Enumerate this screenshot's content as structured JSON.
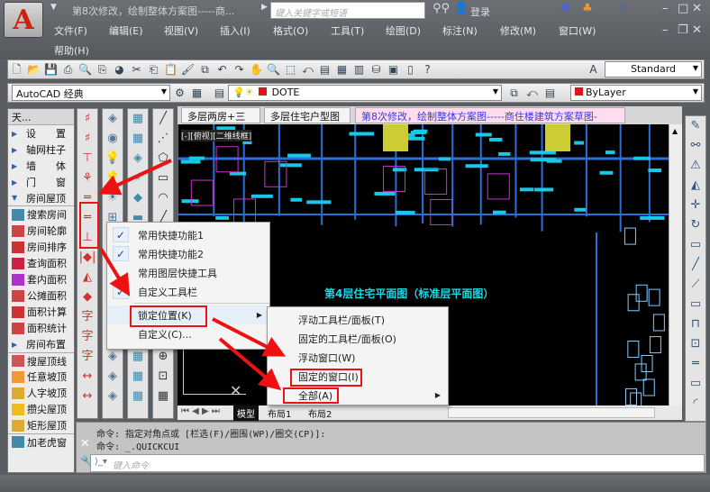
{
  "titlebar": {
    "title": "第8次修改，绘制整体方案图-----商...",
    "search_placeholder": "键入关键字或短语",
    "login": "登录"
  },
  "menu": [
    "文件(F)",
    "编辑(E)",
    "视图(V)",
    "插入(I)",
    "格式(O)",
    "工具(T)",
    "绘图(D)",
    "标注(N)",
    "修改(M)",
    "窗口(W)",
    "帮助(H)"
  ],
  "toolbar": {
    "text_style": "Standard",
    "workspace": "AutoCAD 经典",
    "layer": "DOTE",
    "color": "ByLayer",
    "layer_color": "#e0141e"
  },
  "left_panel": {
    "header": "天...",
    "sections": [
      "设　　置",
      "轴网柱子",
      "墙　　体",
      "门　　窗",
      "房间屋顶"
    ],
    "items": [
      "搜索房间",
      "房间轮廓",
      "房间排序",
      "查询面积",
      "套内面积",
      "公摊面积",
      "面积计算",
      "面积统计",
      "房间布置",
      "搜屋顶线",
      "任意坡顶",
      "人字坡顶",
      "攒尖屋顶",
      "矩形屋顶",
      "加老虎窗"
    ]
  },
  "drawing_tabs": [
    "多层两房+三房",
    "多层住宅户型图",
    "第8次修改，绘制整体方案图-----商住楼建筑方案草图-"
  ],
  "viewport_label": "[-][俯视][二维线框]",
  "drawing_title": "第4层住宅平面图（标准层平面图）",
  "layout_tabs": [
    "模型",
    "布局1",
    "布局2"
  ],
  "context_menu": {
    "items": [
      {
        "label": "常用快捷功能1",
        "checked": true
      },
      {
        "label": "常用快捷功能2",
        "checked": true
      },
      {
        "label": "常用图层快捷工具",
        "checked": false
      },
      {
        "label": "自定义工具栏",
        "checked": true
      },
      {
        "label": "锁定位置(K)",
        "submenu": true
      },
      {
        "label": "自定义(C)..."
      }
    ]
  },
  "submenu": {
    "items": [
      "浮动工具栏/面板(T)",
      "固定的工具栏/面板(O)",
      "浮动窗口(W)",
      "固定的窗口(I)",
      "全部(A)"
    ]
  },
  "command": {
    "line1": "命令:  指定对角点或 [栏选(F)/圈围(WP)/圈交(CP)]:",
    "line2": "命令:  _.QUICKCUI",
    "placeholder": "键入命令"
  },
  "colors": {
    "annotation": "#e11111",
    "cad_line": "#19c8e6",
    "wall": "#2b6fd8"
  }
}
